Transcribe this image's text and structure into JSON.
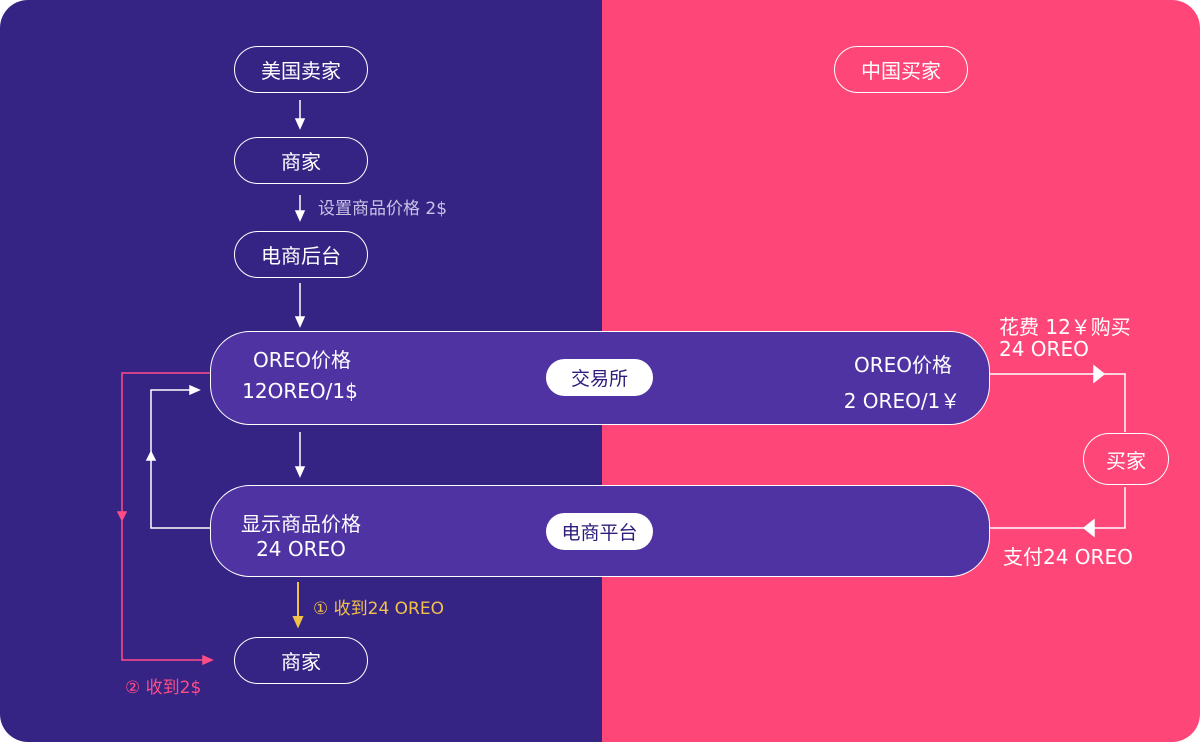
{
  "colors": {
    "left_bg": "#362484",
    "right_bg": "#ff4678",
    "bar_fill": "#4f33a3",
    "gold_arrow": "#f1c14a",
    "pink_line": "#ff4c86"
  },
  "nodes": {
    "us_seller": "美国卖家",
    "merchant_top": "商家",
    "ecommerce_backend": "电商后台",
    "cn_buyer": "中国买家",
    "buyer": "买家",
    "merchant_bottom": "商家"
  },
  "exchange_bar": {
    "badge": "交易所",
    "left_title": "OREO价格",
    "left_rate": "12OREO/1$",
    "right_title": "OREO价格",
    "right_rate": "2 OREO/1￥"
  },
  "platform_bar": {
    "badge": "电商平台",
    "left_title": "显示商品价格",
    "left_value": "24 OREO"
  },
  "labels": {
    "set_price": "设置商品价格 2$",
    "spend": "花费 12￥购买",
    "spend_amount": "24 OREO",
    "pay": "支付24 OREO",
    "receive_oreo": "① 收到24 OREO",
    "receive_usd": "② 收到2$"
  }
}
